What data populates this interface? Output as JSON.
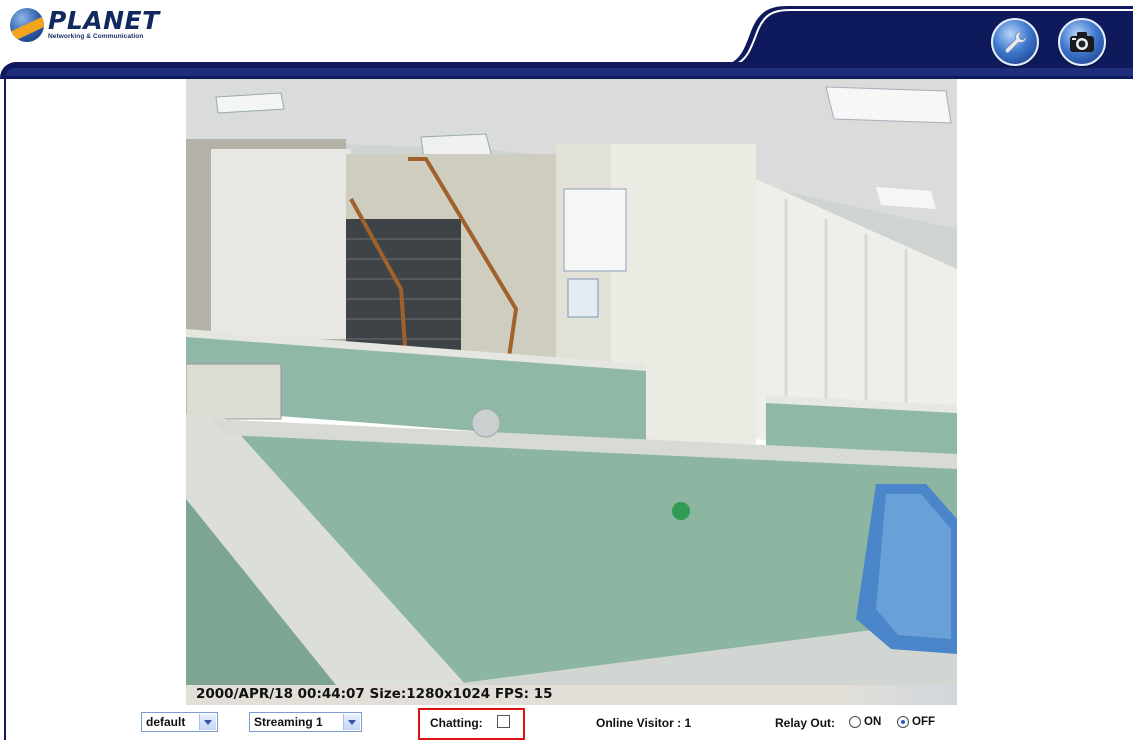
{
  "header": {
    "logo_name": "PLANET",
    "logo_tagline": "Networking & Communication",
    "buttons": [
      {
        "icon": "wrench-icon",
        "label": "setup"
      },
      {
        "icon": "camera-icon",
        "label": "snapshot"
      }
    ],
    "colors": {
      "band": "#0f1a5c",
      "accent": "#2f63c0"
    }
  },
  "video": {
    "status_text": "2000/APR/18 00:44:07 Size:1280x1024 FPS: 15"
  },
  "controls": {
    "profile_select": "default",
    "stream_select": "Streaming 1",
    "chatting_label": "Chatting:",
    "chatting_checked": false,
    "online_visitor_label": "Online Visitor : 1",
    "relay_label": "Relay Out:",
    "relay_on_label": "ON",
    "relay_off_label": "OFF",
    "relay_selected": "OFF"
  }
}
